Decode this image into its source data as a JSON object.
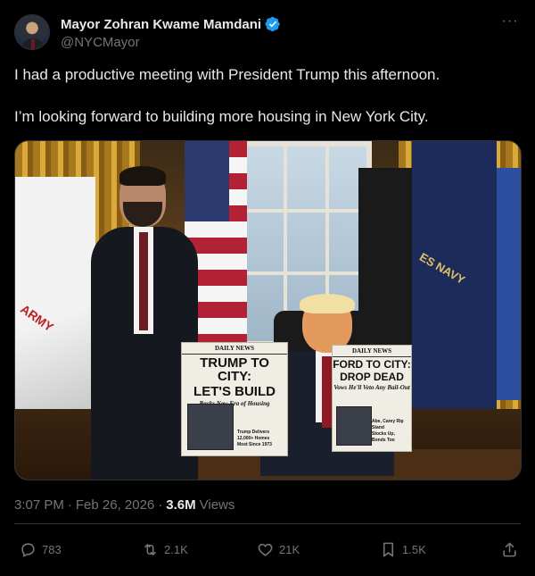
{
  "author": {
    "display_name": "Mayor Zohran Kwame Mamdani",
    "handle": "@NYCMayor",
    "verified": true
  },
  "post": {
    "lines": [
      "I had a productive meeting with President Trump this afternoon.",
      "I’m looking forward to building more housing in New York City."
    ]
  },
  "media": {
    "left_paper": {
      "masthead": "DAILY NEWS",
      "headline_1": "TRUMP TO CITY:",
      "headline_2": "LET'S BUILD",
      "subhead": "Backs New Era of Housing",
      "col_text": "Trump Delivers 12,000+ Homes",
      "col_text_2": "Most Since 1973"
    },
    "right_paper": {
      "masthead": "DAILY NEWS",
      "headline_1": "FORD TO CITY:",
      "headline_2": "DROP DEAD",
      "subhead": "Vows He'll Veto Any Bail-Out",
      "col_text": "Abe, Carey Rip Stand",
      "col_text_2": "Stocks Up, Bonds Too"
    },
    "flag_texts": {
      "army": "ARMY",
      "navy": "ES NAVY"
    }
  },
  "meta": {
    "time": "3:07 PM",
    "separator": "·",
    "date": "Feb 26, 2026",
    "views_count": "3.6M",
    "views_label": "Views"
  },
  "actions": {
    "replies": "783",
    "reposts": "2.1K",
    "likes": "21K",
    "bookmarks": "1.5K"
  },
  "colors": {
    "background": "#000000",
    "text": "#e7e9ea",
    "secondary": "#71767b",
    "verified": "#1d9bf0",
    "border": "#2f3336"
  }
}
